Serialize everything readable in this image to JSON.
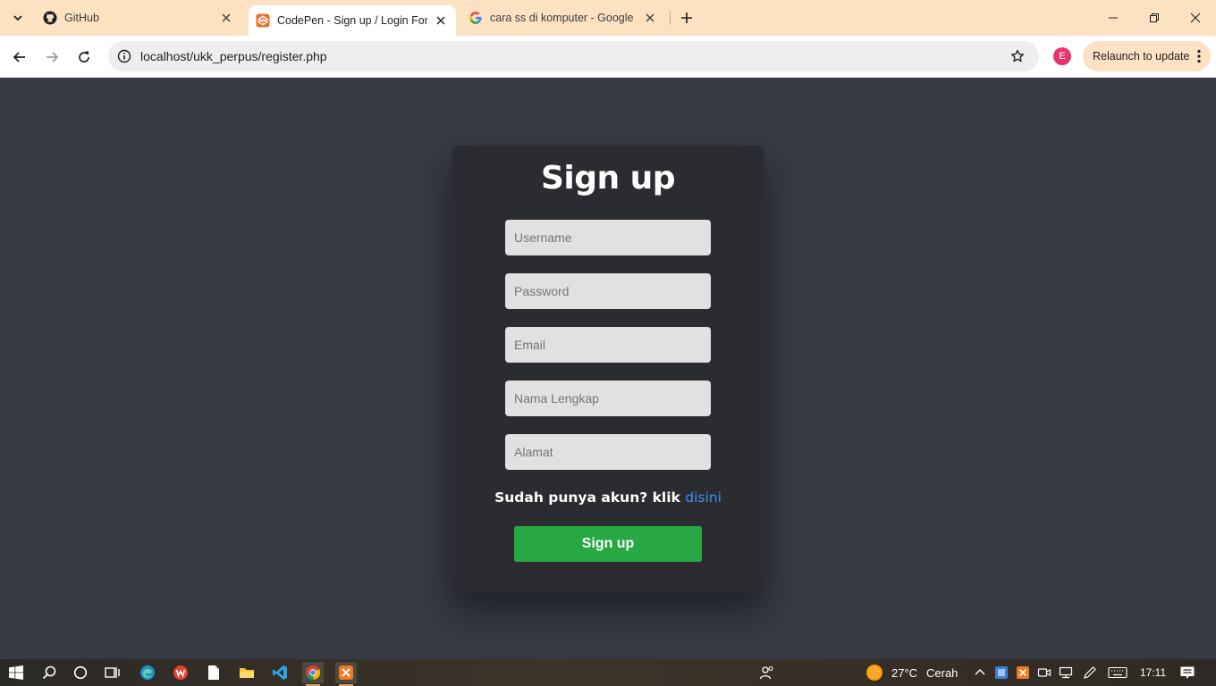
{
  "browser": {
    "tabs": [
      {
        "title": "GitHub",
        "icon": "github-icon"
      },
      {
        "title": "CodePen - Sign up / Login Form",
        "icon": "codepen-icon"
      },
      {
        "title": "cara ss di komputer - Google Search",
        "icon": "google-icon"
      }
    ],
    "url": "localhost/ukk_perpus/register.php",
    "profile_initial": "E",
    "relaunch_label": "Relaunch to update"
  },
  "form": {
    "title": "Sign up",
    "fields": [
      {
        "placeholder": "Username"
      },
      {
        "placeholder": "Password"
      },
      {
        "placeholder": "Email"
      },
      {
        "placeholder": "Nama Lengkap"
      },
      {
        "placeholder": "Alamat"
      }
    ],
    "login_prompt": "Sudah punya akun? klik ",
    "login_link": "disini",
    "submit_label": "Sign up"
  },
  "taskbar": {
    "weather_temp": "27°C",
    "weather_desc": "Cerah",
    "time": "17:11"
  },
  "colors": {
    "page_bg": "#363a44",
    "card_bg": "#2a2c31",
    "field_bg": "#e2e0e1",
    "accent_button": "#28a745",
    "link": "#3b8ff5",
    "tabstrip": "#fde1c3"
  }
}
